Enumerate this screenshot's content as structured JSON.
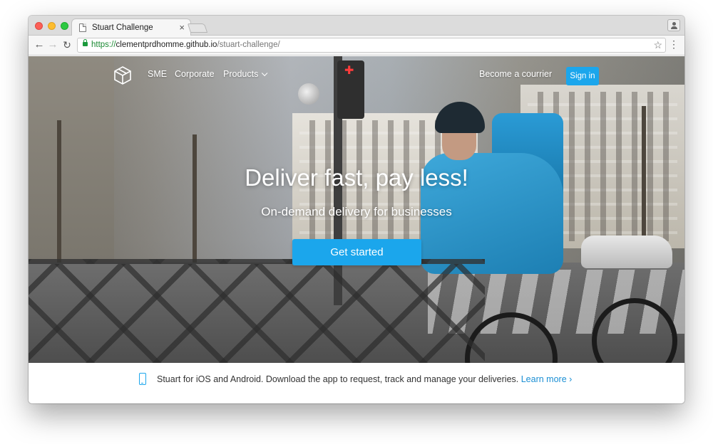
{
  "browser": {
    "tab_title": "Stuart Challenge",
    "tab_close": "×",
    "url_scheme": "https://",
    "url_host": "clementprdhomme.github.io",
    "url_path": "/stuart-challenge/",
    "back_glyph": "←",
    "forward_glyph": "→",
    "reload_glyph": "↻",
    "star_glyph": "☆",
    "menu_glyph": "⋮"
  },
  "nav": {
    "items": [
      {
        "label": "SME"
      },
      {
        "label": "Corporate"
      },
      {
        "label": "Products"
      }
    ],
    "courier_label": "Become a courrier",
    "signin_label": "Sign in"
  },
  "hero": {
    "headline": "Deliver fast, pay less!",
    "subline": "On-demand delivery for businesses",
    "cta_label": "Get started"
  },
  "banner": {
    "text": "Stuart for iOS and Android. Download the app to request, track and manage your deliveries.",
    "link_label": "Learn more ›"
  },
  "colors": {
    "accent": "#1ba6ec",
    "link": "#1b8fd4",
    "secure": "#1b8a33"
  },
  "icons": [
    "page-icon",
    "lock-icon",
    "star-icon",
    "menu-icon",
    "profile-icon",
    "logo-icon",
    "chevron-down-icon",
    "phone-icon"
  ]
}
